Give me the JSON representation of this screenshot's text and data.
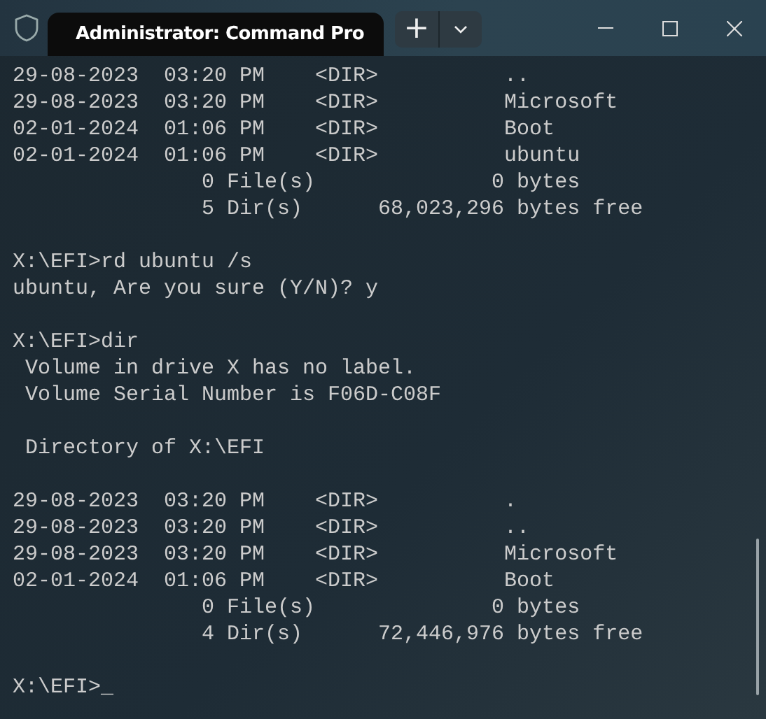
{
  "tab": {
    "title": "Administrator: Command Pro"
  },
  "new_tab": "+",
  "blocks": [
    {
      "lines": [
        "29-08-2023  03:20 PM    <DIR>          ..",
        "29-08-2023  03:20 PM    <DIR>          Microsoft",
        "02-01-2024  01:06 PM    <DIR>          Boot",
        "02-01-2024  01:06 PM    <DIR>          ubuntu",
        "               0 File(s)              0 bytes",
        "               5 Dir(s)      68,023,296 bytes free"
      ]
    },
    {
      "lines": [
        "X:\\EFI>rd ubuntu /s",
        "ubuntu, Are you sure (Y/N)? y"
      ]
    },
    {
      "lines": [
        "X:\\EFI>dir",
        " Volume in drive X has no label.",
        " Volume Serial Number is F06D-C08F"
      ]
    },
    {
      "lines": [
        " Directory of X:\\EFI"
      ]
    },
    {
      "lines": [
        "29-08-2023  03:20 PM    <DIR>          .",
        "29-08-2023  03:20 PM    <DIR>          ..",
        "29-08-2023  03:20 PM    <DIR>          Microsoft",
        "02-01-2024  01:06 PM    <DIR>          Boot",
        "               0 File(s)              0 bytes",
        "               4 Dir(s)      72,446,976 bytes free"
      ]
    },
    {
      "lines": [
        "X:\\EFI>_"
      ]
    }
  ]
}
